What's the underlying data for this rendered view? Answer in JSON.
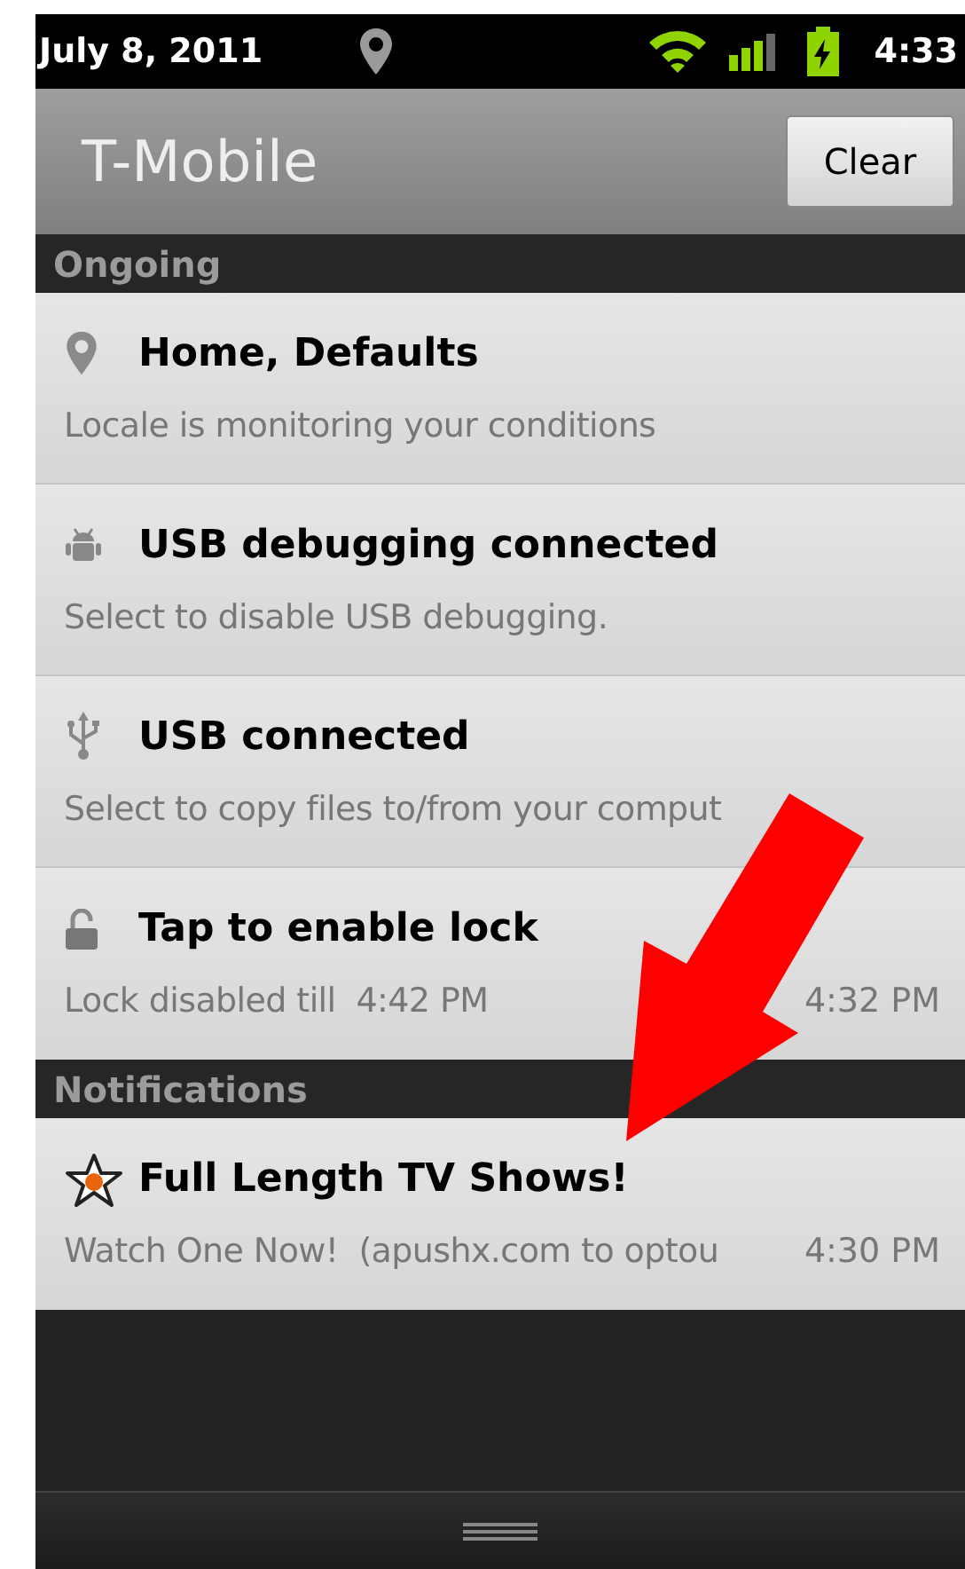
{
  "status_bar": {
    "date": "July 8, 2011",
    "time": "4:33"
  },
  "header": {
    "carrier": "T-Mobile",
    "clear_button": "Clear"
  },
  "sections": [
    {
      "title": "Ongoing",
      "items": [
        {
          "kind": "pin",
          "title": "Home, Defaults",
          "text": "Locale is monitoring your conditions"
        },
        {
          "kind": "bug",
          "title": "USB debugging connected",
          "text": "Select to disable USB debugging."
        },
        {
          "kind": "usb",
          "title": "USB connected",
          "text": "Select to copy files to/from your comput"
        },
        {
          "kind": "lock",
          "title": "Tap to enable lock",
          "text": "Lock disabled till  4:42 PM",
          "time": "4:32 PM"
        }
      ]
    },
    {
      "title": "Notifications",
      "items": [
        {
          "kind": "star",
          "title": "Full Length TV Shows!",
          "text": "Watch One Now!  (apushx.com to optou",
          "time": "4:30 PM"
        }
      ]
    }
  ]
}
